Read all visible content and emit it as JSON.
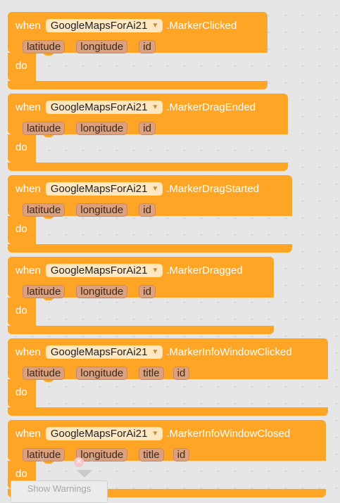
{
  "blocks": [
    {
      "keyword": "when",
      "component": "GoogleMapsForAi21",
      "event": ".MarkerClicked",
      "params": [
        "latitude",
        "longitude",
        "id"
      ],
      "do": "do"
    },
    {
      "keyword": "when",
      "component": "GoogleMapsForAi21",
      "event": ".MarkerDragEnded",
      "params": [
        "latitude",
        "longitude",
        "id"
      ],
      "do": "do"
    },
    {
      "keyword": "when",
      "component": "GoogleMapsForAi21",
      "event": ".MarkerDragStarted",
      "params": [
        "latitude",
        "longitude",
        "id"
      ],
      "do": "do"
    },
    {
      "keyword": "when",
      "component": "GoogleMapsForAi21",
      "event": ".MarkerDragged",
      "params": [
        "latitude",
        "longitude",
        "id"
      ],
      "do": "do"
    },
    {
      "keyword": "when",
      "component": "GoogleMapsForAi21",
      "event": ".MarkerInfoWindowClicked",
      "params": [
        "latitude",
        "longitude",
        "title",
        "id"
      ],
      "do": "do"
    },
    {
      "keyword": "when",
      "component": "GoogleMapsForAi21",
      "event": ".MarkerInfoWindowClosed",
      "params": [
        "latitude",
        "longitude",
        "title",
        "id"
      ],
      "do": "do"
    }
  ],
  "warnings": {
    "warning_count": "0",
    "error_count": "0",
    "button_label": "Show Warnings"
  },
  "icons": {
    "dropdown": "chevron-down-icon",
    "error": "error-icon",
    "warning": "warning-icon"
  }
}
